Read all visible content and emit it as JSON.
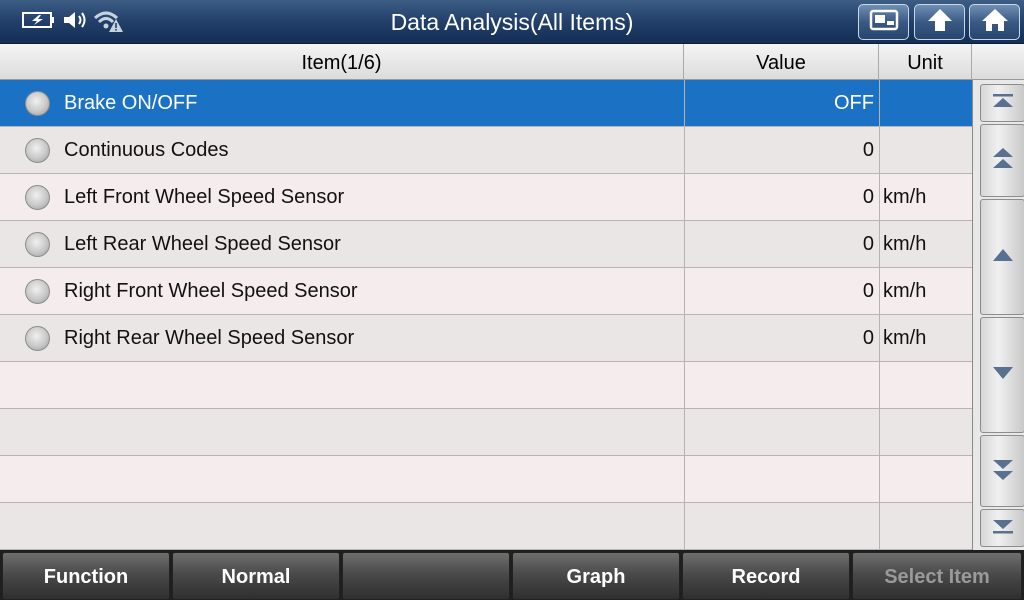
{
  "title": "Data Analysis(All Items)",
  "status_icons": [
    "battery-charging-icon",
    "speaker-icon",
    "wifi-warning-icon"
  ],
  "top_buttons": [
    "screenshot-icon",
    "back-icon",
    "home-icon"
  ],
  "columns": {
    "item": "Item(1/6)",
    "value": "Value",
    "unit": "Unit"
  },
  "rows": [
    {
      "item": "Brake ON/OFF",
      "value": "OFF",
      "unit": "",
      "selected": true
    },
    {
      "item": "Continuous Codes",
      "value": "0",
      "unit": ""
    },
    {
      "item": "Left Front Wheel Speed Sensor",
      "value": "0",
      "unit": "km/h"
    },
    {
      "item": "Left Rear Wheel Speed Sensor",
      "value": "0",
      "unit": "km/h"
    },
    {
      "item": "Right Front Wheel Speed Sensor",
      "value": "0",
      "unit": "km/h"
    },
    {
      "item": "Right Rear Wheel Speed Sensor",
      "value": "0",
      "unit": "km/h"
    }
  ],
  "bottom": {
    "function": "Function",
    "normal": "Normal",
    "empty": "",
    "graph": "Graph",
    "record": "Record",
    "select_item": "Select Item"
  },
  "colors": {
    "selected_row": "#1b72c4",
    "titlebar": "#22406a"
  }
}
